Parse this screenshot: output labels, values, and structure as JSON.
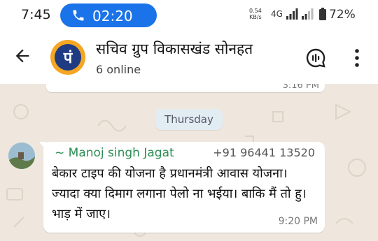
{
  "status_bar": {
    "time": "7:45",
    "call_timer": "02:20",
    "net_speed_value": "0.54",
    "net_speed_unit": "KB/s",
    "network_type": "4G",
    "battery_percent": "72%"
  },
  "header": {
    "group_name": "सचिव ग्रुप विकासखंड सोनहत",
    "status": "6 online",
    "avatar_letter": "पं"
  },
  "chat": {
    "previous_message_time": "3:16 PM",
    "day_divider": "Thursday",
    "message": {
      "sender_name": "~ Manoj singh Jagat",
      "sender_phone": "+91 96441 13520",
      "text": "बेकार टाइप की योजना है प्रधानमंत्री आवास योजना। ज्यादा क्या दिमाग लगाना पेलो ना भईया। बाकि मैं तो हु। भाड़ में जाए।",
      "time": "9:20 PM"
    }
  },
  "colors": {
    "call_pill": "#1a73e8",
    "sender_name": "#2f8f55",
    "chat_background": "#efe7de"
  }
}
